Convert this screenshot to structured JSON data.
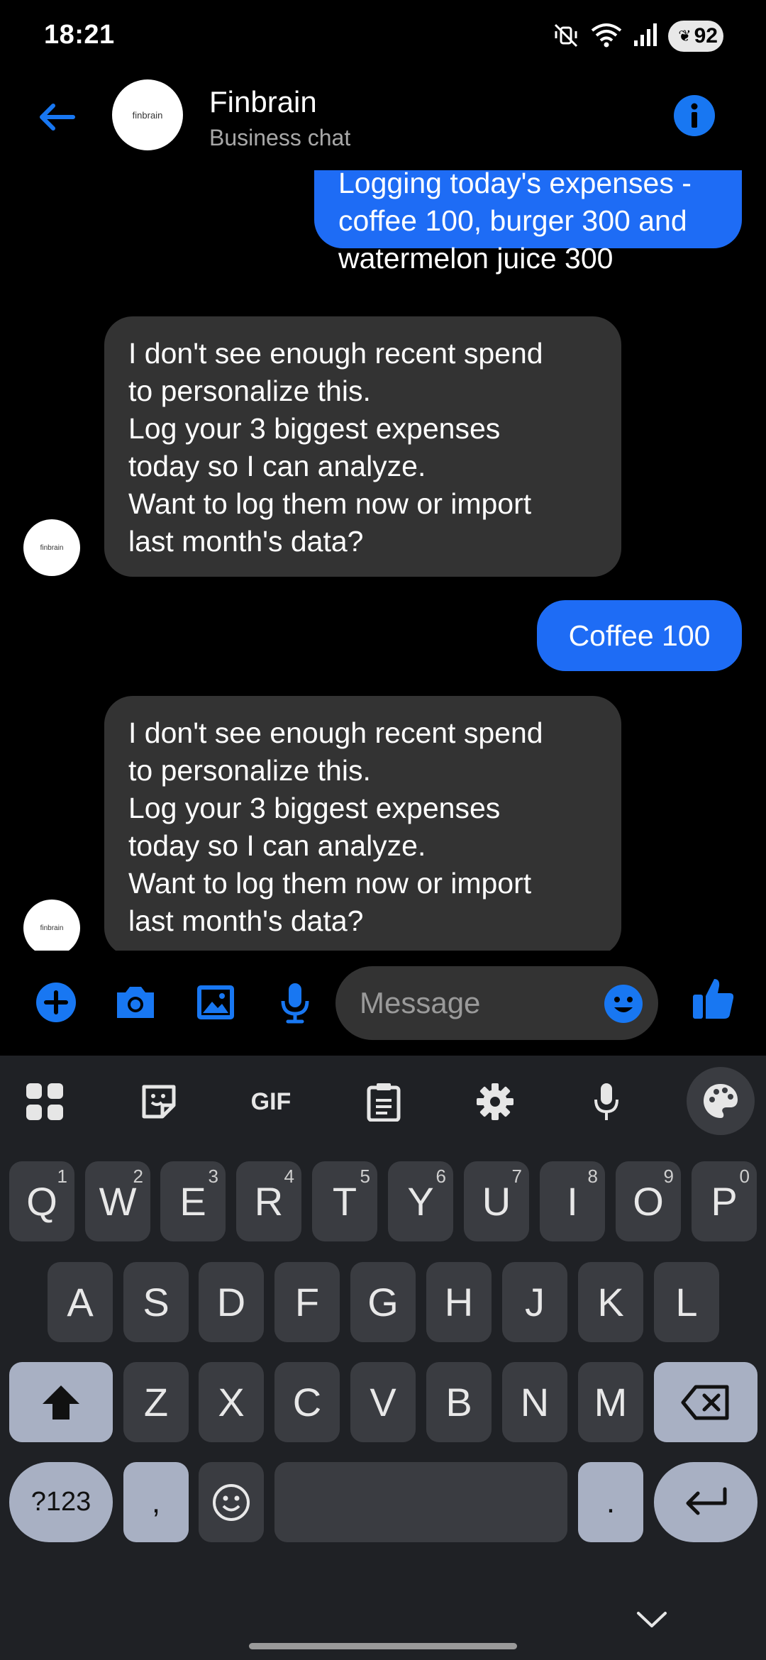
{
  "status_bar": {
    "time": "18:21",
    "battery": "92",
    "icons": [
      "mute-vibrate-icon",
      "wifi-icon",
      "signal-icon",
      "battery-saver-leaf-icon"
    ]
  },
  "header": {
    "title": "Finbrain",
    "subtitle": "Business chat",
    "avatar_text": "finbrain",
    "accent_color": "#1877f2"
  },
  "messages": [
    {
      "direction": "outgoing",
      "text": "Logging today's expenses -\ncoffee 100, burger 300 and\nwatermelon juice 300"
    },
    {
      "direction": "incoming",
      "text": "I don't see enough recent spend\nto personalize this.\nLog your 3 biggest expenses\ntoday so I can analyze.\nWant to log them now or import\nlast month's data?"
    },
    {
      "direction": "outgoing",
      "text": "Coffee 100"
    },
    {
      "direction": "incoming",
      "text": "I don't see enough recent spend\nto personalize this.\nLog your 3 biggest expenses\ntoday so I can analyze.\nWant to log them now or import\nlast month's data?"
    }
  ],
  "composer": {
    "placeholder": "Message",
    "icons": [
      "plus-icon",
      "camera-icon",
      "gallery-icon",
      "microphone-icon",
      "emoji-icon",
      "thumbs-up-icon"
    ]
  },
  "keyboard": {
    "toolbar": [
      "apps-grid-icon",
      "sticker-icon",
      "GIF",
      "clipboard-icon",
      "settings-icon",
      "voice-icon",
      "palette-icon"
    ],
    "row1": [
      {
        "k": "Q",
        "n": "1"
      },
      {
        "k": "W",
        "n": "2"
      },
      {
        "k": "E",
        "n": "3"
      },
      {
        "k": "R",
        "n": "4"
      },
      {
        "k": "T",
        "n": "5"
      },
      {
        "k": "Y",
        "n": "6"
      },
      {
        "k": "U",
        "n": "7"
      },
      {
        "k": "I",
        "n": "8"
      },
      {
        "k": "O",
        "n": "9"
      },
      {
        "k": "P",
        "n": "0"
      }
    ],
    "row2": [
      "A",
      "S",
      "D",
      "F",
      "G",
      "H",
      "J",
      "K",
      "L"
    ],
    "row3": [
      "Z",
      "X",
      "C",
      "V",
      "B",
      "N",
      "M"
    ],
    "symbols_key": "?123",
    "comma": ",",
    "period": "."
  }
}
